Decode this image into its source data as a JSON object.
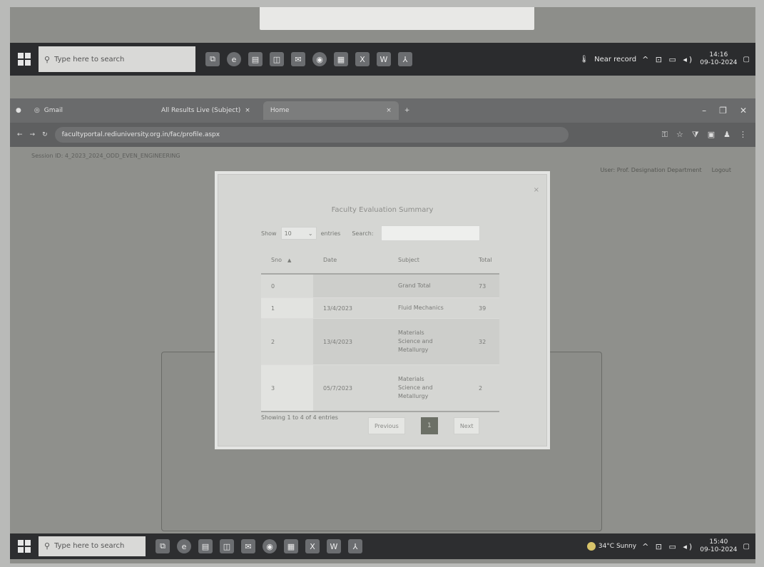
{
  "top_taskbar": {
    "search_placeholder": "Type here to search",
    "app_icons": [
      "task-view-icon",
      "edge-icon",
      "file-explorer-icon",
      "store-icon",
      "mail-icon",
      "chrome-icon",
      "calculator-icon",
      "excel-icon",
      "word-icon",
      "acrobat-icon"
    ],
    "status": "Near record",
    "tray": "^ ⊡ ▭ ◂)",
    "time": "14:16",
    "date": "09-10-2024"
  },
  "browser": {
    "tabs": [
      {
        "label": "Gmail"
      },
      {
        "label": "All Results Live (Subject)"
      },
      {
        "label": "Home"
      }
    ],
    "new_tab": "+",
    "url": "facultyportal.rediuniversity.org.in/fac/profile.aspx"
  },
  "page": {
    "session_text": "Session ID: 4_2023_2024_ODD_EVEN_ENGINEERING",
    "user_label": "User:",
    "user_name": "Prof. Designation Department",
    "logout": "Logout"
  },
  "modal": {
    "title": "Faculty Evaluation Summary",
    "show_label": "Show",
    "entries_value": "10",
    "entries_label": "entries",
    "search_label": "Search:",
    "search_value": "",
    "columns": [
      "Sno",
      "Date",
      "Subject",
      "Total"
    ],
    "rows": [
      {
        "sno": "0",
        "date": "",
        "subject": "Grand Total",
        "total": "73"
      },
      {
        "sno": "1",
        "date": "13/4/2023",
        "subject": "Fluid Mechanics",
        "total": "39"
      },
      {
        "sno": "2",
        "date": "13/4/2023",
        "subject": "Materials Science and Metallurgy",
        "total": "32"
      },
      {
        "sno": "3",
        "date": "05/7/2023",
        "subject": "Materials Science and Metallurgy",
        "total": "2"
      }
    ],
    "info": "Showing 1 to 4 of 4 entries",
    "prev": "Previous",
    "page": "1",
    "next": "Next",
    "close": "×"
  },
  "bottom_taskbar": {
    "search_placeholder": "Type here to search",
    "weather": "34°C Sunny",
    "tray": "^ ⊡ ▭ ◂)",
    "time": "15:40",
    "date": "09-10-2024"
  }
}
